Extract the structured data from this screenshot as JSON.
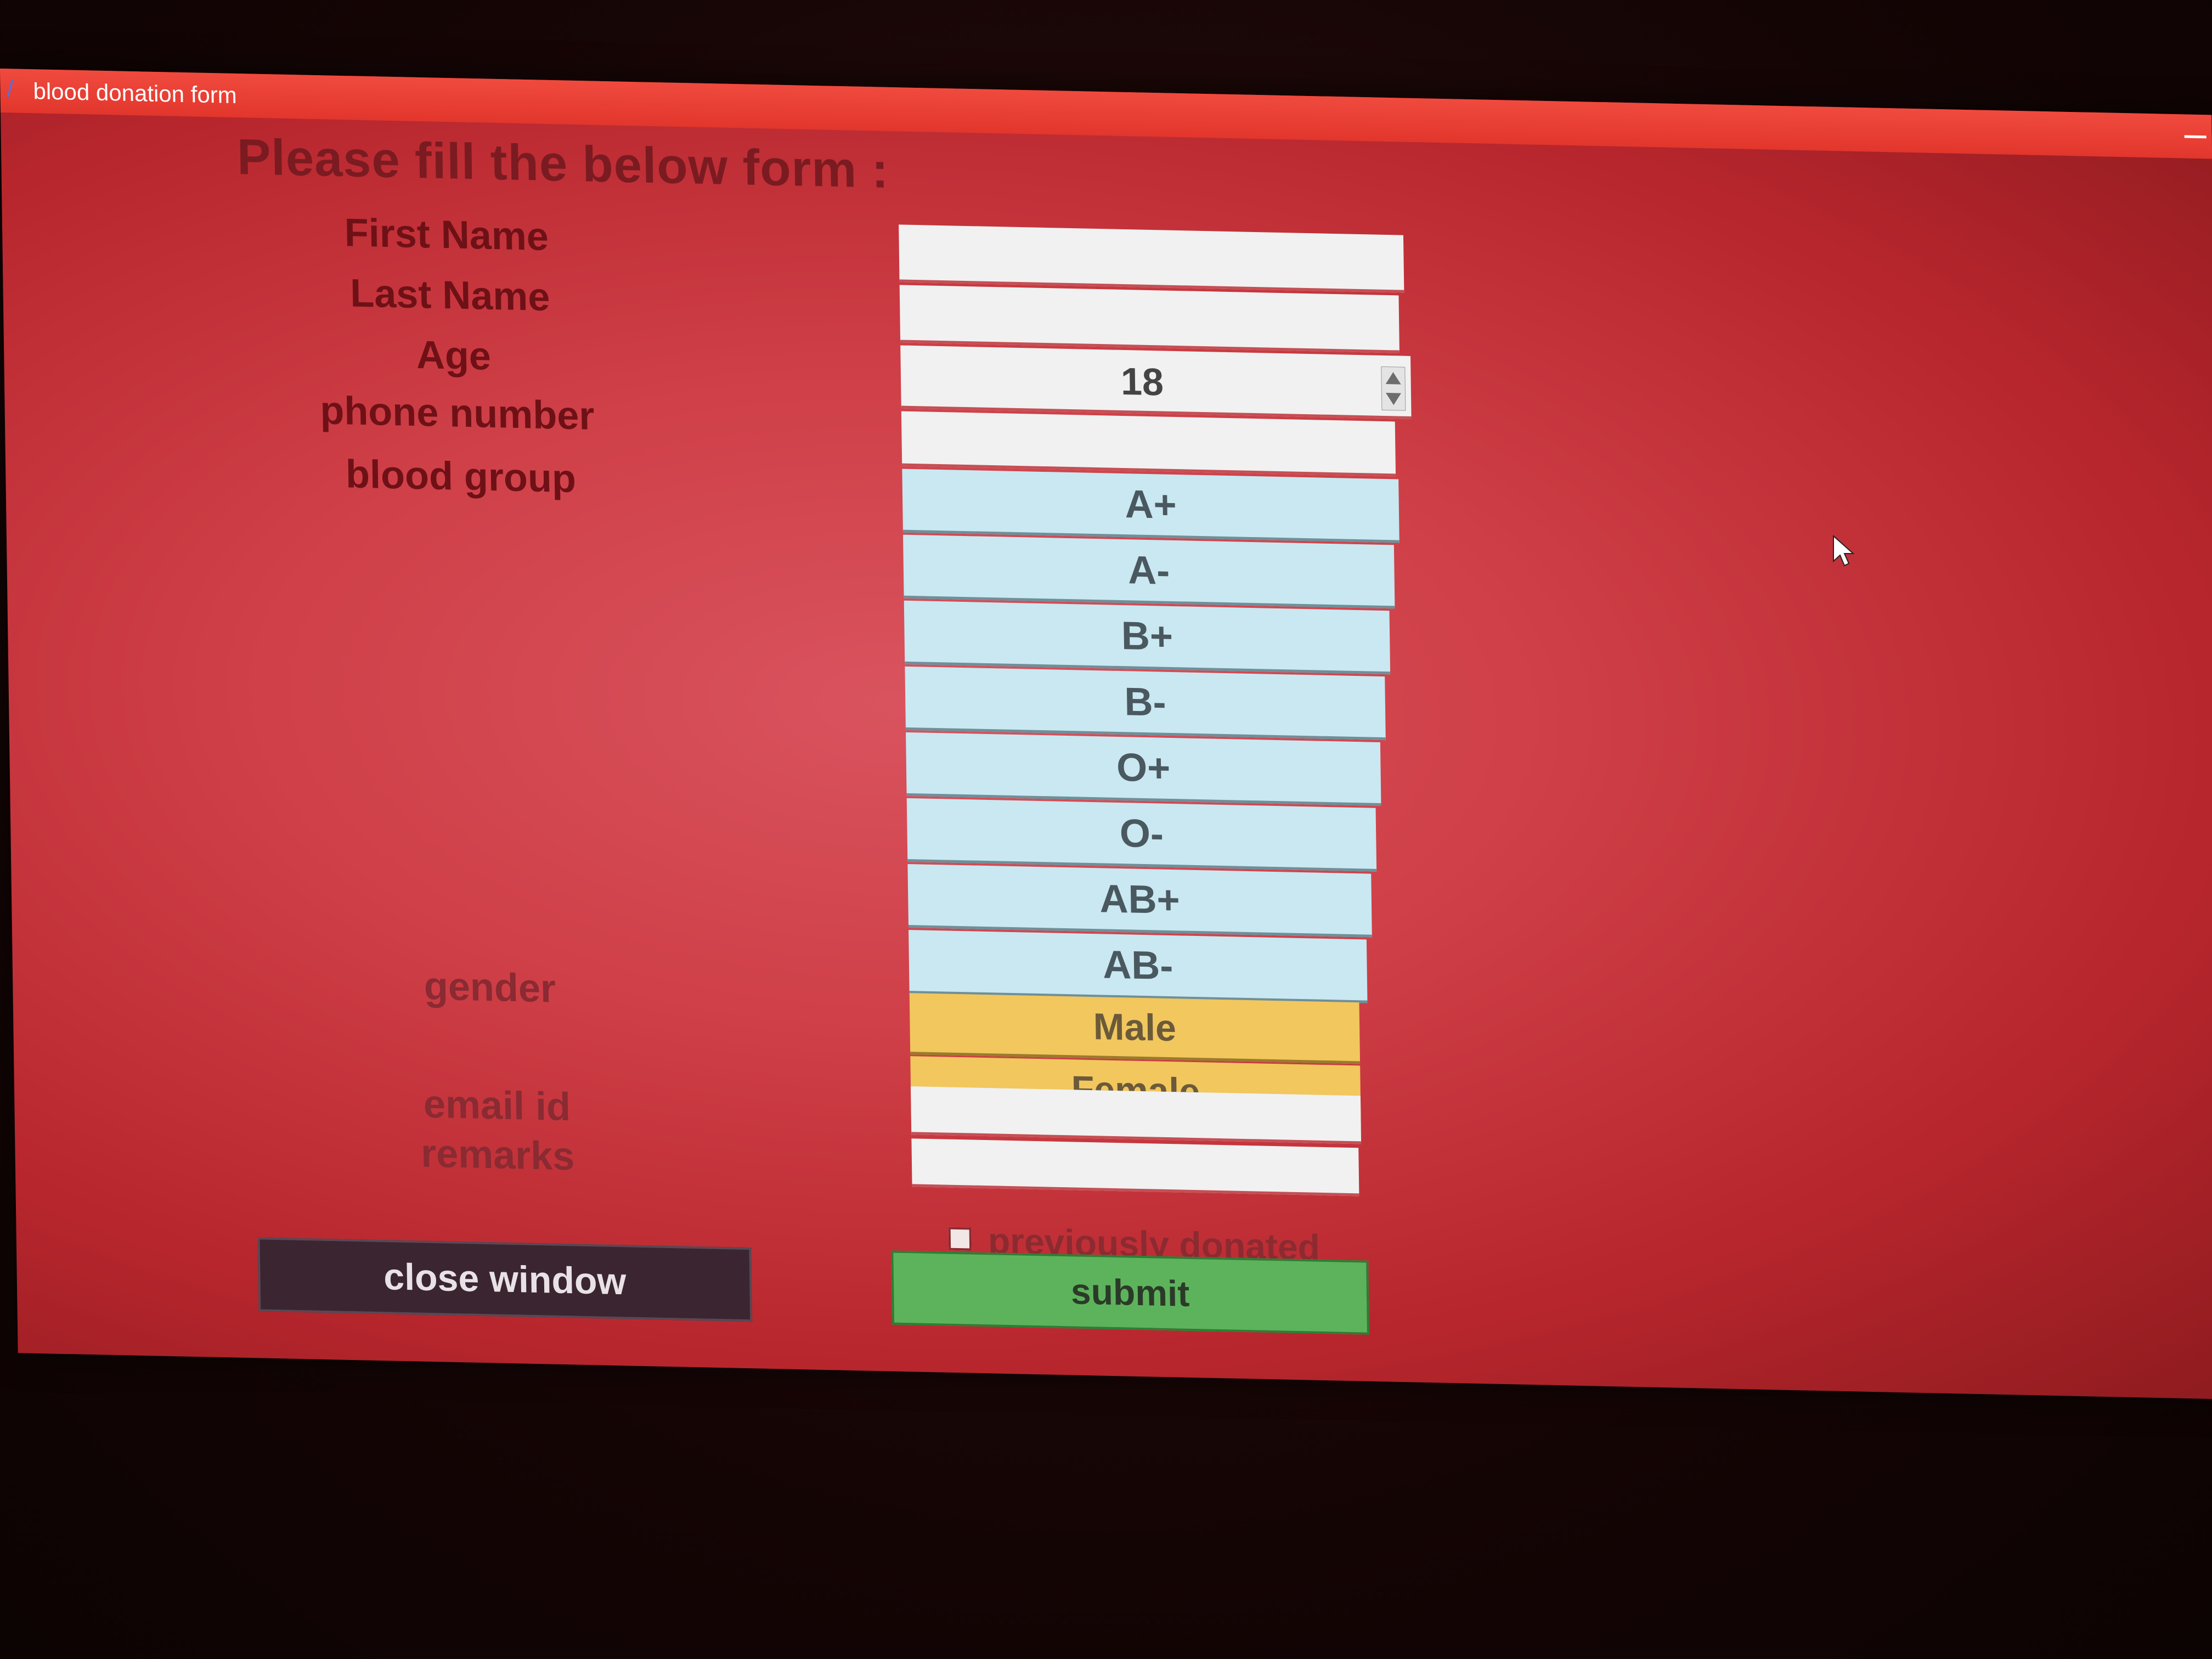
{
  "window": {
    "title": "blood donation form",
    "title_icon": "feather-icon"
  },
  "form": {
    "heading": "Please fill the below form :",
    "labels": {
      "first_name": "First Name",
      "last_name": "Last Name",
      "age": "Age",
      "phone": "phone number",
      "blood_group": "blood group",
      "gender": "gender",
      "email": "email id",
      "remarks": "remarks"
    },
    "fields": {
      "first_name": "",
      "last_name": "",
      "age": "18",
      "phone": "",
      "email": "",
      "remarks": ""
    },
    "blood_groups": [
      "A+",
      "A-",
      "B+",
      "B-",
      "O+",
      "O-",
      "AB+",
      "AB-"
    ],
    "genders": [
      "Male",
      "Female"
    ],
    "checkbox_label": "previously donated",
    "checkbox_checked": false,
    "close_label": "close window",
    "submit_label": "submit"
  },
  "colors": {
    "background": "#cf3f47",
    "titlebar": "#e2362c",
    "list_bg": "#c9e8f1",
    "gender_bg": "#f1c75e",
    "submit_bg": "#5db35c",
    "close_bg": "#3a2530"
  }
}
